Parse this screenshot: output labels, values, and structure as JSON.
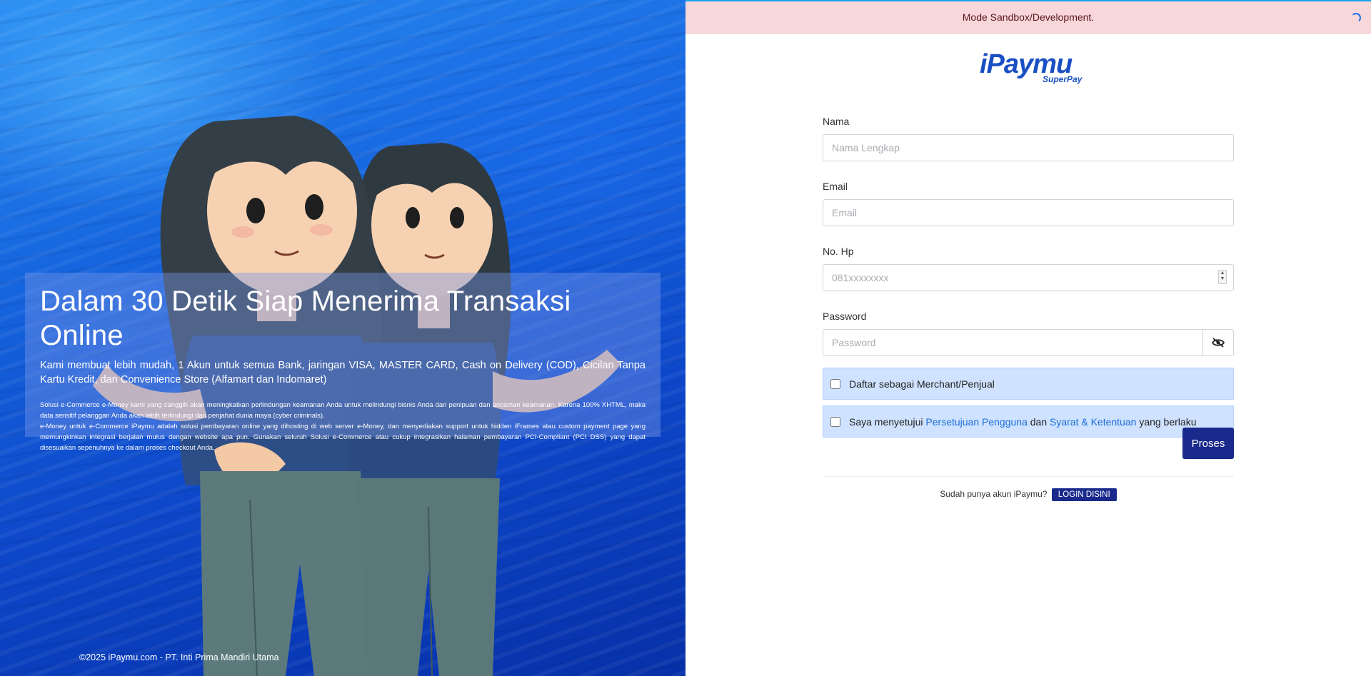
{
  "hero": {
    "title": "Dalam 30 Detik Siap Menerima Transaksi Online",
    "subtitle": "Kami membuat lebih mudah, 1 Akun untuk semua Bank, jaringan VISA, MASTER CARD, Cash on Delivery (COD), Cicilan Tanpa Kartu Kredit, dan Convenience Store (Alfamart dan Indomaret)",
    "paragraph1": "Solusi e-Commerce e-Money kami yang canggih akan meningkatkan perlindungan keamanan Anda untuk melindungi bisnis Anda dari penipuan dan ancaman keamanan. Karena 100% XHTML, maka data sensitif pelanggan Anda akan lebih terlindungi dari penjahat dunia maya (cyber criminals).",
    "paragraph2": "e-Money untuk e-Commerce iPaymu adalah solusi pembayaran online yang dihosting di web server e-Money, dan menyediakan support untuk hidden iFrames atau custom payment page yang memungkinkan integrasi berjalan mulus dengan website apa pun. Gunakan seluruh Solusi e-Commerce atau cukup integrasikan halaman pembayaran PCI-Compliant (PCI DSS) yang dapat disesuaikan sepenuhnya ke dalam proses checkout Anda.",
    "copyright": "©2025 iPaymu.com - PT. Inti Prima Mandiri Utama"
  },
  "banner": {
    "text": "Mode Sandbox/Development."
  },
  "logo": {
    "main": "iPaymu",
    "sub": "SuperPay"
  },
  "form": {
    "name": {
      "label": "Nama",
      "placeholder": "Nama Lengkap"
    },
    "email": {
      "label": "Email",
      "placeholder": "Email"
    },
    "phone": {
      "label": "No. Hp",
      "placeholder": "081xxxxxxxx"
    },
    "password": {
      "label": "Password",
      "placeholder": "Password"
    },
    "merchant_check": {
      "label": "Daftar sebagai Merchant/Penjual"
    },
    "agree_check": {
      "prefix": "Saya menyetujui",
      "link1": "Persetujuan Pengguna",
      "middle": "dan",
      "link2": "Syarat & Ketentuan",
      "suffix": "yang berlaku"
    },
    "submit_label": "Proses",
    "login_prompt": "Sudah punya akun iPaymu?",
    "login_button": "LOGIN DISINI"
  },
  "colors": {
    "primary": "#1a2a8c",
    "banner_bg": "#f8d7da",
    "check_bg": "#cfe2ff",
    "link": "#1a6ed8"
  },
  "icons": {
    "password_toggle": "eye-slash-icon",
    "loading": "spinner-icon"
  }
}
